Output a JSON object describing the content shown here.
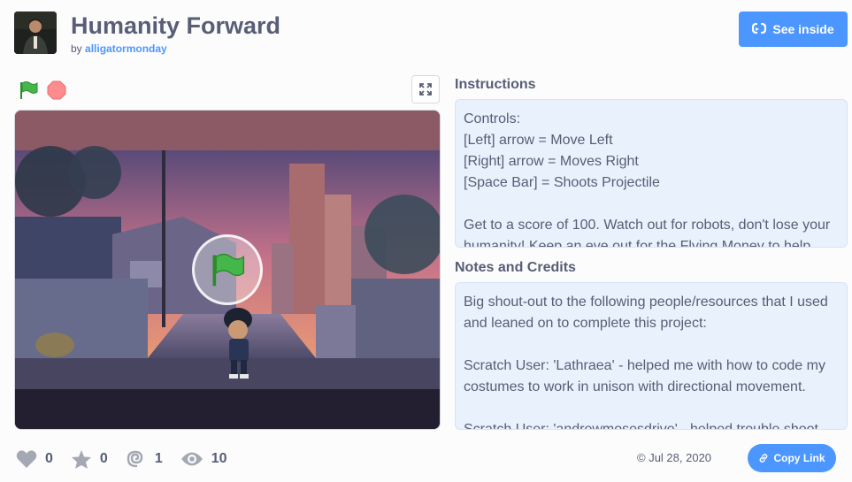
{
  "project": {
    "title": "Humanity Forward",
    "by_label": "by",
    "author": "alligatormonday"
  },
  "header": {
    "see_inside_label": "See inside"
  },
  "player": {
    "green_flag_icon": "green-flag-icon",
    "stop_icon": "stop-icon",
    "fullscreen_icon": "fullscreen-icon"
  },
  "instructions": {
    "title": "Instructions",
    "lines": [
      "Controls:",
      "[Left] arrow = Move Left",
      "[Right] arrow = Moves Right",
      "[Space Bar] = Shoots Projectile",
      "",
      "Get to a score of 100. Watch out for robots, don't lose your",
      "humanity! Keep an eye out for the Flying Money to help"
    ]
  },
  "notes": {
    "title": "Notes and Credits",
    "lines": [
      "Big shout-out to the following people/resources that I used",
      "and leaned on to complete this project:",
      "",
      "Scratch User: 'Lathraea' - helped me with how to code my",
      "costumes to work in unison with directional movement.",
      "",
      "Scratch User: 'andrewmosesdrive' - helped trouble shoot"
    ]
  },
  "stats": {
    "loves": "0",
    "favorites": "0",
    "remixes": "1",
    "views": "10"
  },
  "footer": {
    "date": "© Jul 28, 2020",
    "copy_link_label": "Copy Link"
  },
  "colors": {
    "accent": "#4c97ff",
    "text": "#575e75",
    "panel_bg": "#e9f1fc",
    "green_flag": "#45b649",
    "stop": "#ff8c8c"
  }
}
